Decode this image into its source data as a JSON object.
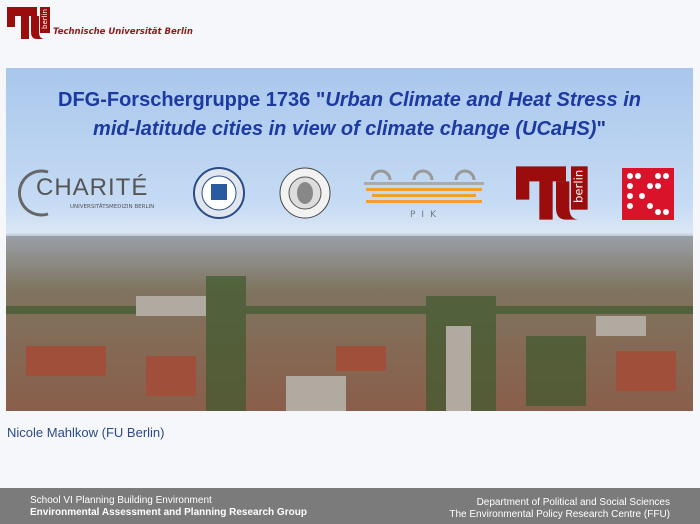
{
  "header": {
    "university_name": "Technische Universität Berlin",
    "logo": "tu-berlin-logo"
  },
  "hero": {
    "title_plain": "DFG-Forschergruppe 1736 \"",
    "title_italic_1": "Urban Climate and Heat Stress in",
    "title_italic_2": "mid-latitude cities in view of climate change (UCaHS)",
    "title_end": "\"",
    "logos": {
      "charite_name": "CHARITÉ",
      "charite_sub": "UNIVERSITÄTSMEDIZIN BERLIN",
      "fu": "fu-berlin-seal",
      "hu": "humboldt-universitaet-seal",
      "pik": "PIK",
      "tu": "tu-berlin-logo",
      "udk": "udk-berlin-logo"
    },
    "image": "berlin-city-aerial-photo"
  },
  "presenter": "Nicole Mahlkow (FU Berlin)",
  "footer": {
    "left_line1": "School VI Planning Building Environment",
    "left_line2": "Environmental Assessment and Planning Research Group",
    "right_line1": "Department of Political and Social Sciences",
    "right_line2": "The Environmental Policy Research Centre (FFU)"
  },
  "colors": {
    "tu_red": "#9b0d0d",
    "title_blue": "#1c3aa0",
    "footer_gray": "#7b7b7b"
  }
}
